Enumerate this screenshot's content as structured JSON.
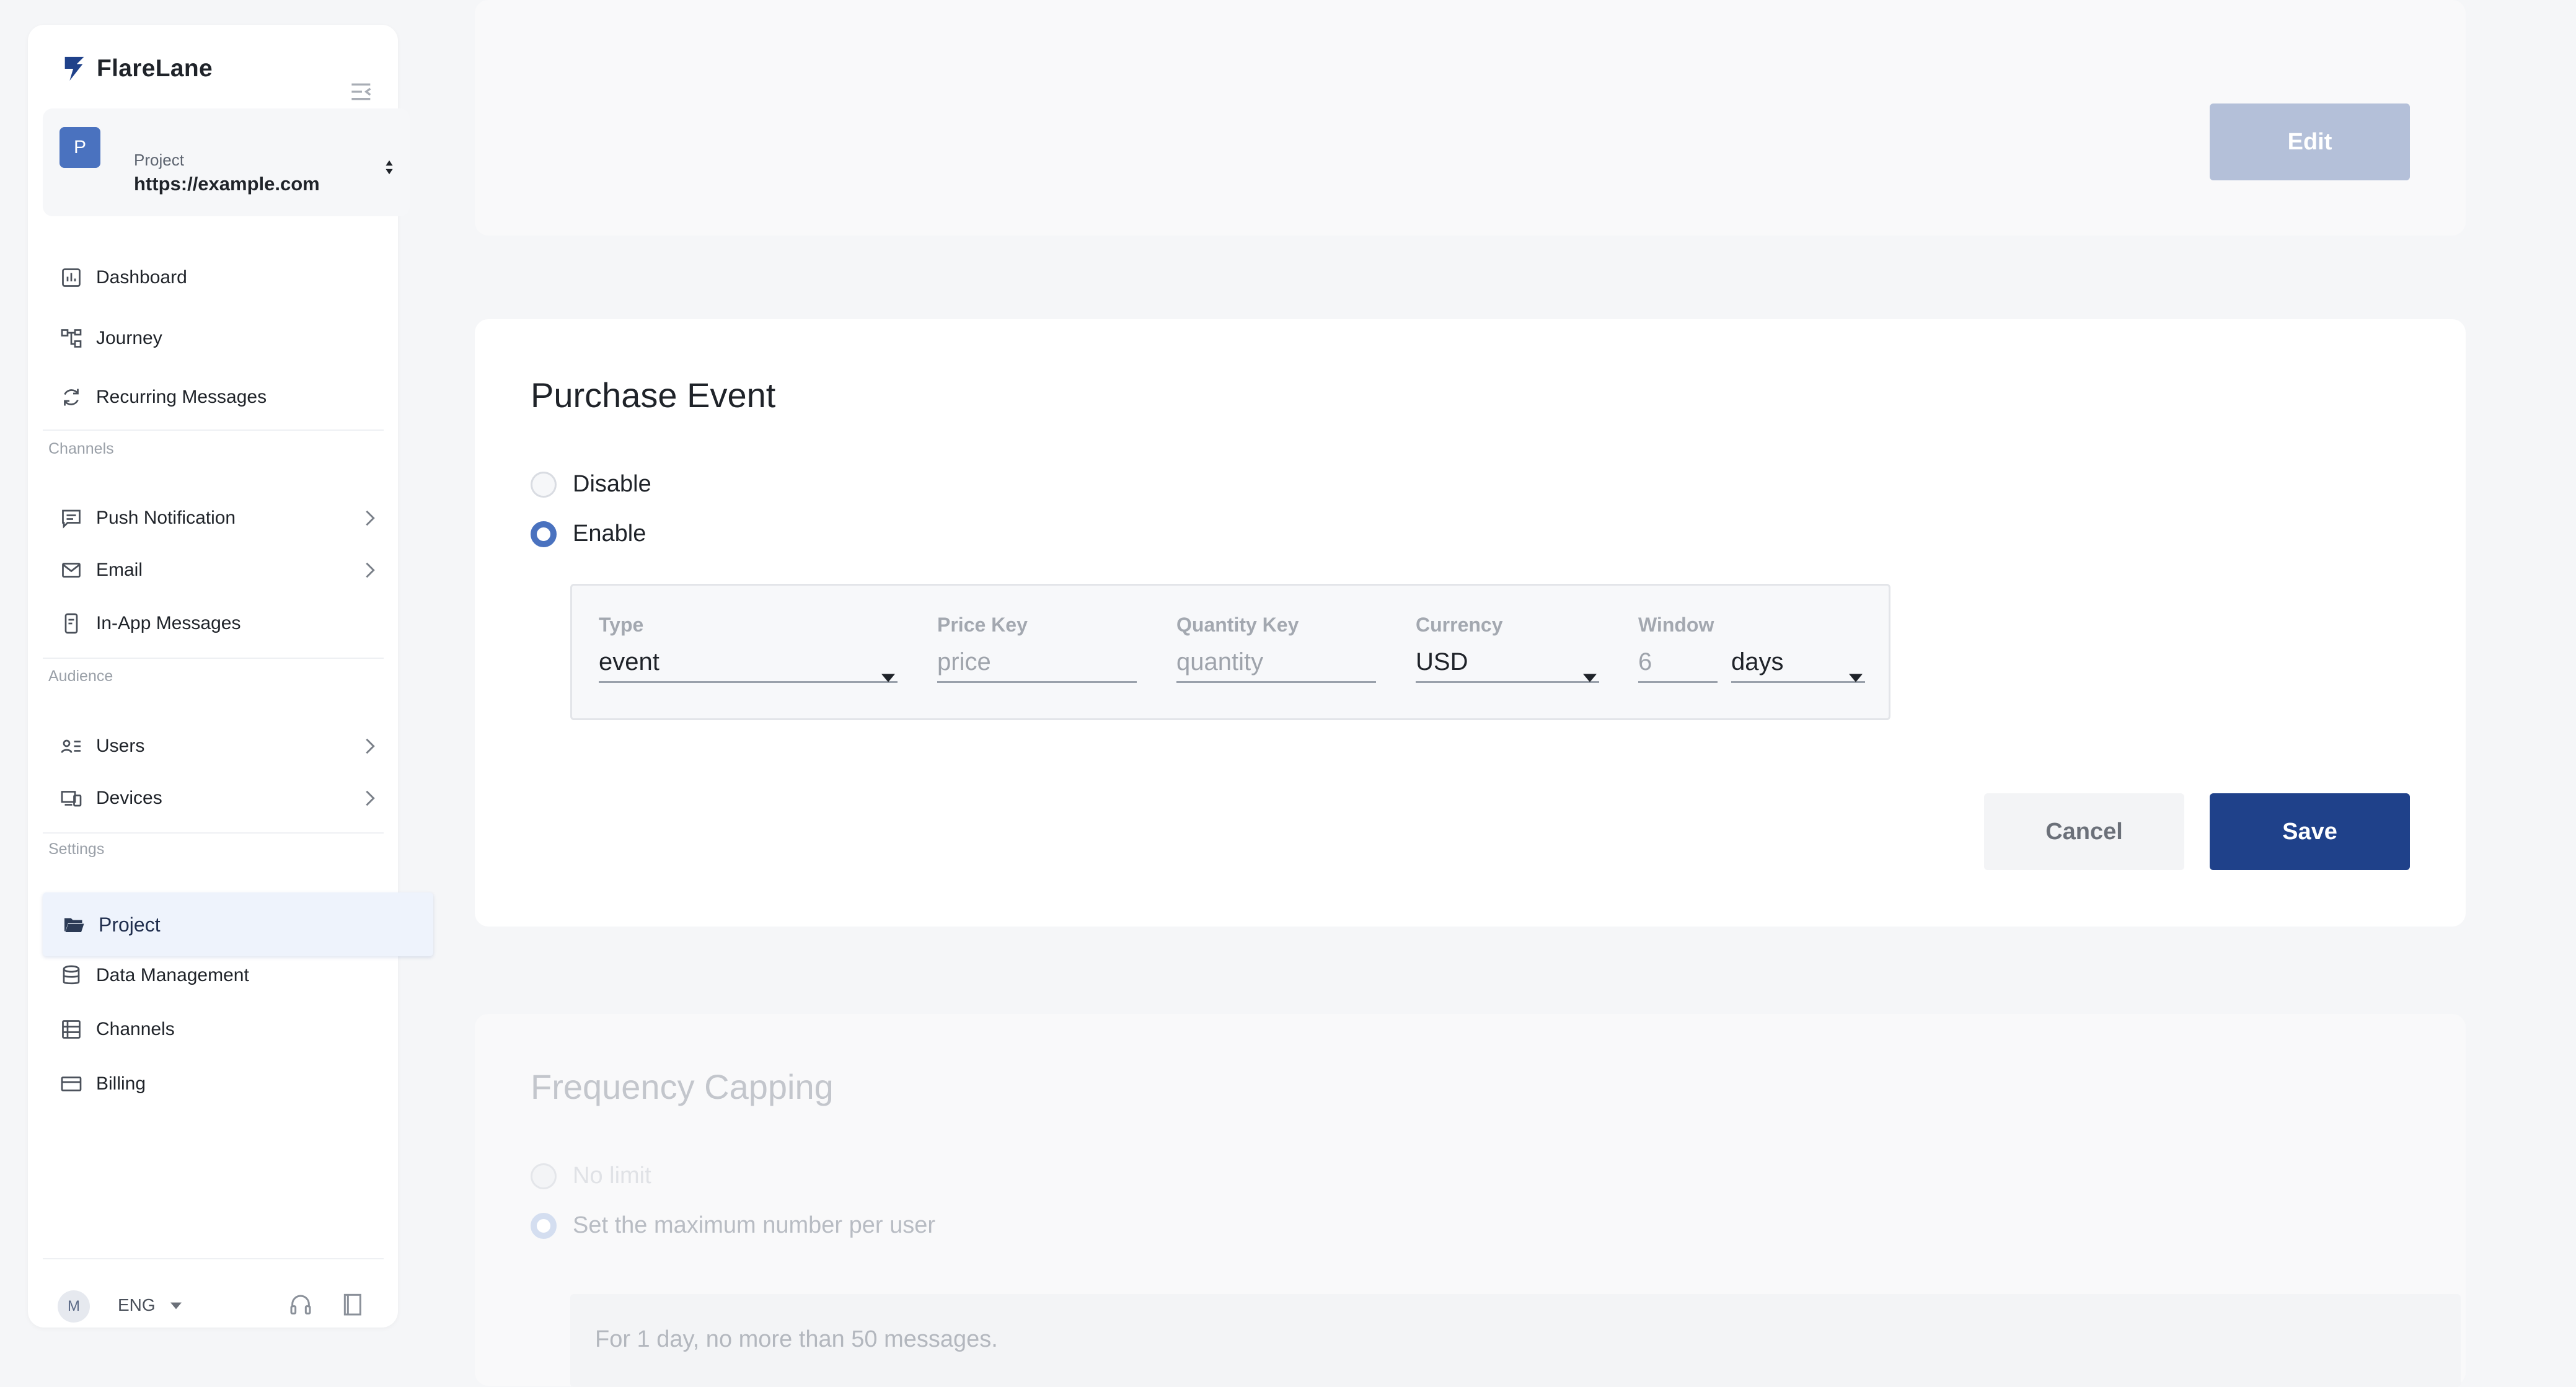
{
  "app": {
    "name": "FlareLane"
  },
  "project": {
    "kicker": "Project",
    "avatar_letter": "P",
    "url": "https://example.com"
  },
  "nav": {
    "main": [
      {
        "label": "Dashboard",
        "icon": "chart-icon"
      },
      {
        "label": "Journey",
        "icon": "flow-icon"
      },
      {
        "label": "Recurring Messages",
        "icon": "refresh-icon"
      }
    ],
    "channels_label": "Channels",
    "channels": [
      {
        "label": "Push Notification",
        "icon": "message-icon"
      },
      {
        "label": "Email",
        "icon": "mail-icon"
      },
      {
        "label": "In-App Messages",
        "icon": "phone-icon"
      }
    ],
    "audience_label": "Audience",
    "audience": [
      {
        "label": "Users",
        "icon": "users-icon"
      },
      {
        "label": "Devices",
        "icon": "devices-icon"
      }
    ],
    "settings_label": "Settings",
    "settings": [
      {
        "label": "Project",
        "icon": "folder-icon",
        "active": true
      },
      {
        "label": "Data Management",
        "icon": "database-icon"
      },
      {
        "label": "Channels",
        "icon": "list-icon"
      },
      {
        "label": "Billing",
        "icon": "card-icon"
      }
    ]
  },
  "footer": {
    "avatar_letter": "M",
    "language": "ENG"
  },
  "top_card": {
    "edit_label": "Edit"
  },
  "purchase_event": {
    "title": "Purchase Event",
    "options": [
      {
        "label": "Disable",
        "selected": false
      },
      {
        "label": "Enable",
        "selected": true
      }
    ],
    "fields": {
      "type": {
        "label": "Type",
        "value": "event"
      },
      "price_key": {
        "label": "Price Key",
        "placeholder": "price"
      },
      "quantity_key": {
        "label": "Quantity Key",
        "placeholder": "quantity"
      },
      "currency": {
        "label": "Currency",
        "value": "USD"
      },
      "window": {
        "label": "Window",
        "value": "6",
        "unit": "days"
      }
    },
    "cancel_label": "Cancel",
    "save_label": "Save"
  },
  "frequency_capping": {
    "title": "Frequency Capping",
    "options": [
      {
        "label": "No limit",
        "selected": false
      },
      {
        "label": "Set the maximum number per user",
        "selected": true
      }
    ],
    "summary": "For 1 day, no more than 50 messages."
  },
  "colors": {
    "primary": "#1f418a",
    "accent": "#4a72bf",
    "edit_disabled": "#b4c0d9"
  }
}
